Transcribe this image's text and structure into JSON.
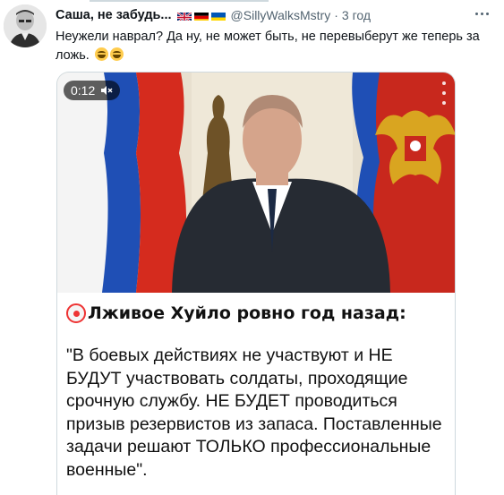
{
  "tweet": {
    "display_name": "Саша, не забудь...",
    "flags": [
      "uk-flag-icon",
      "germany-flag-icon",
      "ukraine-flag-icon"
    ],
    "handle": "@SillyWalksMstry",
    "separator": "·",
    "time": "3 год",
    "text": "Неужели наврал? Да ну, не может быть, не перевыберут же теперь за ложь.",
    "emojis": [
      "grinning-sweat-emoji",
      "grinning-sweat-emoji"
    ]
  },
  "media": {
    "duration": "0:12",
    "caption_title": "Лживое Хуйло ровно год назад:",
    "caption_quote": "\"В боевых действиях не участвуют и НЕ БУДУТ участвовать солдаты, проходящие срочную службу. НЕ БУДЕТ проводиться призыв резервистов из запаса. Поставленные задачи решают ТОЛЬКО профессиональные военные\"."
  },
  "colors": {
    "secondary_text": "#536471",
    "border": "#cfd9de",
    "russian_red": "#d52b1e",
    "russian_blue": "#0039a6"
  }
}
